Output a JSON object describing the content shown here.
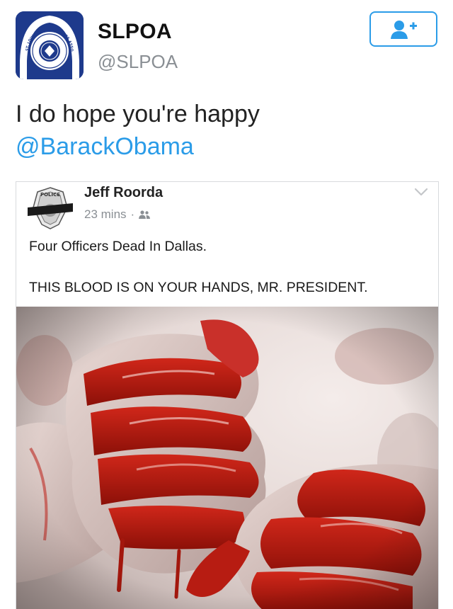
{
  "account": {
    "display_name": "SLPOA",
    "handle": "@SLPOA",
    "avatar_icon": "police-badge-logo-icon",
    "logo_ring_text": "ST. LOUIS POLICE OFFICERS ASSOCIATION"
  },
  "follow_button": {
    "icon": "add-user-icon"
  },
  "tweet": {
    "text_line1": "I do hope you're happy",
    "mention": "@BarackObama"
  },
  "embedded_post": {
    "author": "Jeff Roorda",
    "time": "23 mins",
    "separator": "·",
    "audience_icon": "friends-icon",
    "menu_icon": "chevron-down-icon",
    "line1": "Four Officers Dead In Dallas.",
    "line2": "THIS BLOOD IS ON YOUR HANDS, MR. PRESIDENT.",
    "avatar_badge_text": "POLICE",
    "image": "bloody-hands-photo"
  },
  "colors": {
    "link": "#2b9ce8",
    "avatar_bg": "#1e3a8c",
    "secondary_text": "#8a8f94"
  }
}
